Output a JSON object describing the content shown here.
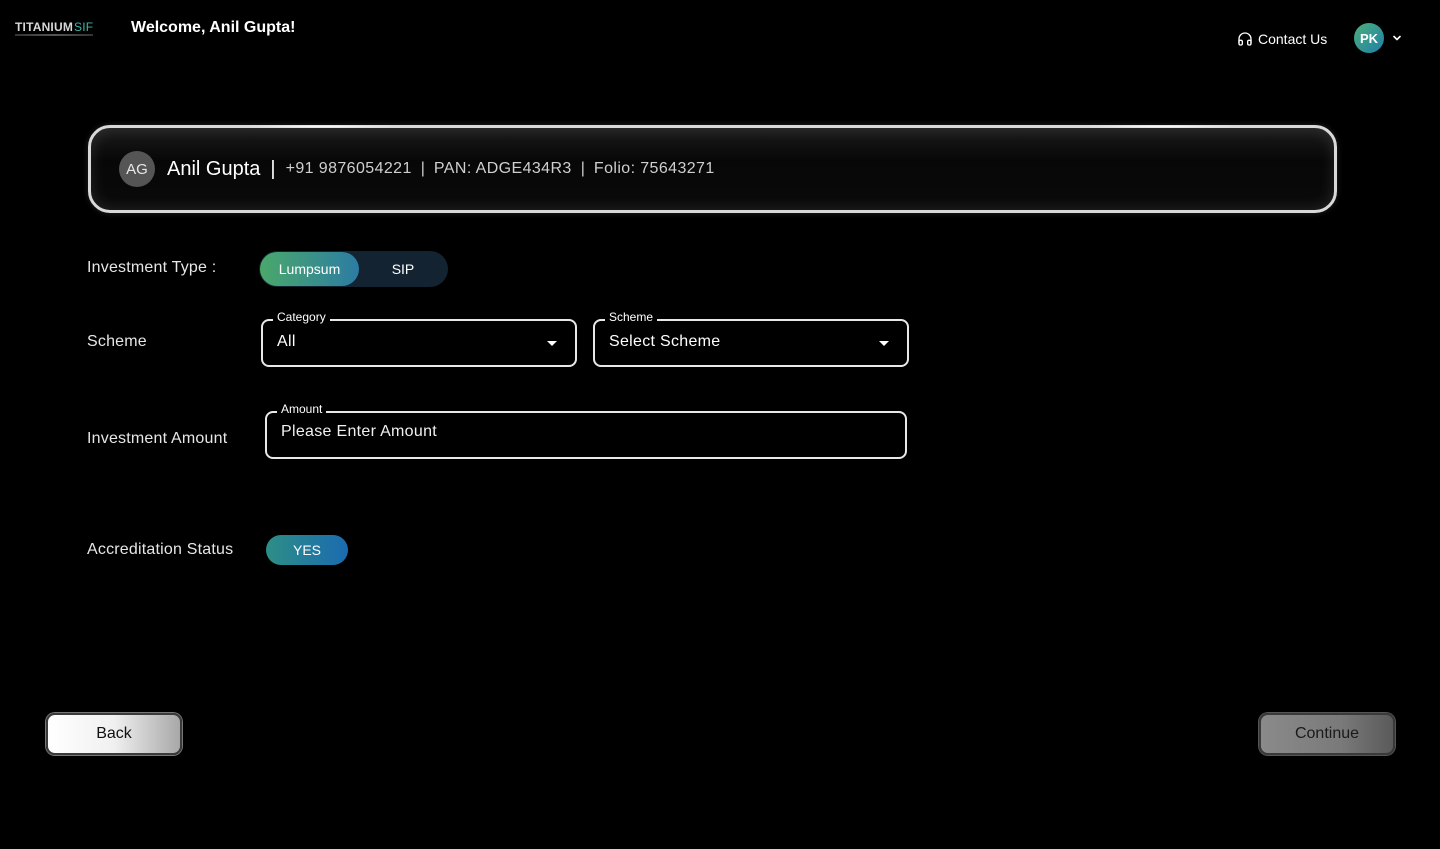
{
  "header": {
    "logo_main": "TITANIUM",
    "logo_accent": "SIF",
    "welcome": "Welcome, Anil Gupta!",
    "contact_label": "Contact Us",
    "contact_icon": "headphones-icon",
    "user_initials": "PK",
    "user_menu_icon": "chevron-down-icon"
  },
  "client": {
    "initials": "AG",
    "name": "Anil Gupta",
    "separator": "|",
    "phone": "+91 9876054221",
    "pan": "PAN: ADGE434R3",
    "folio": "Folio: 75643271"
  },
  "form": {
    "investment_type_label": "Investment Type :",
    "investment_type_options": [
      "Lumpsum",
      "SIP"
    ],
    "investment_type_selected": "Lumpsum",
    "scheme_label": "Scheme",
    "category": {
      "legend": "Category",
      "value": "All"
    },
    "scheme": {
      "legend": "Scheme",
      "value": "Select Scheme"
    },
    "amount_label": "Investment  Amount",
    "amount": {
      "legend": "Amount",
      "placeholder": "Please Enter Amount",
      "value": ""
    },
    "accreditation_label": "Accreditation Status",
    "accreditation_value": "YES"
  },
  "actions": {
    "back_label": "Back",
    "continue_label": "Continue"
  },
  "colors": {
    "background": "#000000",
    "toggle_active_gradient": [
      "#4aa86a",
      "#2c7ca3"
    ],
    "yes_gradient": [
      "#2d8e86",
      "#1a6bb0"
    ],
    "avatar_gradient": [
      "#4caf7a",
      "#1f7fa8"
    ]
  }
}
